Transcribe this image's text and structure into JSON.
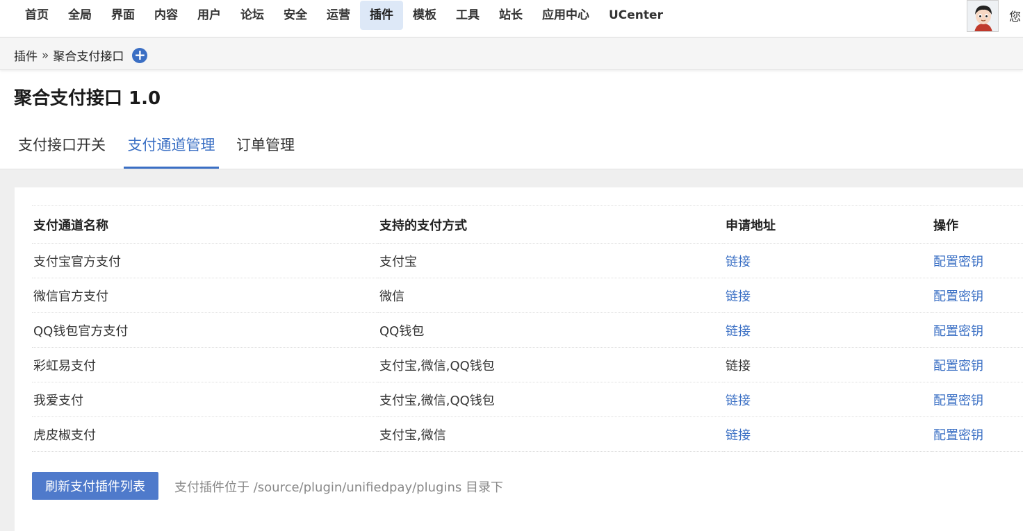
{
  "nav": {
    "items": [
      "首页",
      "全局",
      "界面",
      "内容",
      "用户",
      "论坛",
      "安全",
      "运营",
      "插件",
      "模板",
      "工具",
      "站长",
      "应用中心",
      "UCenter"
    ],
    "active_index": 8,
    "greeting": "您"
  },
  "breadcrumb": {
    "root": "插件",
    "separator": "»",
    "current": "聚合支付接口",
    "add_icon": "plus-circle-icon"
  },
  "page": {
    "title": "聚合支付接口 1.0"
  },
  "tabs": [
    {
      "label": "支付接口开关",
      "active": false
    },
    {
      "label": "支付通道管理",
      "active": true
    },
    {
      "label": "订单管理",
      "active": false
    }
  ],
  "table": {
    "headers": [
      "支付通道名称",
      "支持的支付方式",
      "申请地址",
      "操作"
    ],
    "rows": [
      {
        "name": "支付宝官方支付",
        "methods": "支付宝",
        "apply": "链接",
        "apply_is_link": true,
        "action": "配置密钥"
      },
      {
        "name": "微信官方支付",
        "methods": "微信",
        "apply": "链接",
        "apply_is_link": true,
        "action": "配置密钥"
      },
      {
        "name": "QQ钱包官方支付",
        "methods": "QQ钱包",
        "apply": "链接",
        "apply_is_link": true,
        "action": "配置密钥"
      },
      {
        "name": "彩虹易支付",
        "methods": "支付宝,微信,QQ钱包",
        "apply": "链接",
        "apply_is_link": false,
        "action": "配置密钥"
      },
      {
        "name": "我爱支付",
        "methods": "支付宝,微信,QQ钱包",
        "apply": "链接",
        "apply_is_link": true,
        "action": "配置密钥"
      },
      {
        "name": "虎皮椒支付",
        "methods": "支付宝,微信",
        "apply": "链接",
        "apply_is_link": true,
        "action": "配置密钥"
      }
    ]
  },
  "footer": {
    "refresh_label": "刷新支付插件列表",
    "hint": "支付插件位于 /source/plugin/unifiedpay/plugins 目录下"
  },
  "colors": {
    "accent": "#3a6fc4",
    "button": "#4f7acb",
    "nav_active_bg": "#dde8f7"
  }
}
